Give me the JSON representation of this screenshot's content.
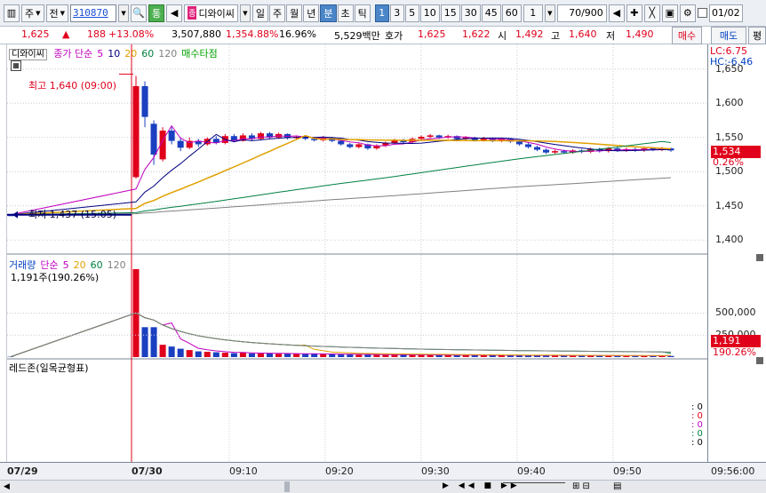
{
  "toolbar": {
    "code": "310870",
    "type1": "주",
    "type2": "전",
    "tong": "통",
    "jong_badge": "종",
    "stock_name": "디와이씨",
    "periods": [
      {
        "label": "일",
        "selected": false
      },
      {
        "label": "주",
        "selected": false
      },
      {
        "label": "월",
        "selected": false
      },
      {
        "label": "년",
        "selected": false
      },
      {
        "label": "분",
        "selected": true
      },
      {
        "label": "초",
        "selected": false
      },
      {
        "label": "틱",
        "selected": false
      }
    ],
    "minutes": [
      {
        "label": "1",
        "selected": true
      },
      {
        "label": "3",
        "selected": false
      },
      {
        "label": "5",
        "selected": false
      },
      {
        "label": "10",
        "selected": false
      },
      {
        "label": "15",
        "selected": false
      },
      {
        "label": "30",
        "selected": false
      },
      {
        "label": "45",
        "selected": false
      },
      {
        "label": "60",
        "selected": false
      }
    ],
    "interval_value": "1",
    "count": "70/900",
    "date": "01/02"
  },
  "quote": {
    "price": "1,625",
    "arrow": "▲",
    "change": "188",
    "change_pct": "+13.08%",
    "volume": "3,507,880",
    "vol_ratio": "1,354.88%",
    "turnover": "16.96%",
    "amount": "5,529백만",
    "hoga_label": "호가",
    "ask": "1,625",
    "bid": "1,622",
    "open_label": "시",
    "open": "1,492",
    "high_label": "고",
    "high": "1,640",
    "low_label": "저",
    "low": "1,490",
    "buy_label": "매수",
    "sell_label": "매도",
    "extra_label": "평"
  },
  "price_pane": {
    "stock_label": "디와이씨",
    "legend": [
      {
        "text": "종가 단순",
        "color": "#c000c0"
      },
      {
        "text": "5",
        "color": "#c000c0"
      },
      {
        "text": "10",
        "color": "#000080"
      },
      {
        "text": "20",
        "color": "#e0a000"
      },
      {
        "text": "60",
        "color": "#008040"
      },
      {
        "text": "120",
        "color": "#808080"
      },
      {
        "text": "매수타점",
        "color": "#00a000"
      }
    ],
    "lc": "LC:6.75",
    "hc": "HC:-6.46",
    "high_marker": "최고 1,640 (09:00)",
    "low_marker": "최저 1,437 (15:05)",
    "ticks": [
      "1,650",
      "1,600",
      "1,550",
      "1,500",
      "1,450",
      "1,400"
    ],
    "current_price": "1,534",
    "current_pct": "0.26%"
  },
  "volume_pane": {
    "legend": [
      {
        "text": "거래량",
        "color": "#0040c0"
      },
      {
        "text": "단순",
        "color": "#c000c0"
      },
      {
        "text": "5",
        "color": "#c000c0"
      },
      {
        "text": "20",
        "color": "#e0a000"
      },
      {
        "text": "60",
        "color": "#008040"
      },
      {
        "text": "120",
        "color": "#808080"
      }
    ],
    "value_text": "1,191주(190.26%)",
    "ticks": [
      "500,000",
      "250,000"
    ],
    "current": "1,191",
    "current_pct": "190.26%"
  },
  "redzone_pane": {
    "title": "레드존(일목균형표)",
    "values": [
      {
        "text": "0",
        "color": "#000000"
      },
      {
        "text": "0",
        "color": "#e0001b"
      },
      {
        "text": "0",
        "color": "#c000c0"
      },
      {
        "text": "0",
        "color": "#008040"
      },
      {
        "text": "0",
        "color": "#000000"
      }
    ]
  },
  "xaxis": {
    "labels": [
      "07/29",
      "07/30",
      "09:10",
      "09:20",
      "09:30",
      "09:40",
      "09:50",
      "09:56:00"
    ]
  },
  "chart_data": {
    "type": "candlestick",
    "title": "",
    "ylim": [
      1390,
      1660
    ],
    "candles": [
      {
        "o": 1437,
        "c": 1437,
        "h": 1437,
        "l": 1437
      },
      {
        "o": 1492,
        "c": 1625,
        "h": 1640,
        "l": 1490,
        "up": true
      },
      {
        "o": 1625,
        "c": 1580,
        "h": 1632,
        "l": 1565
      },
      {
        "o": 1570,
        "c": 1525,
        "h": 1575,
        "l": 1510
      },
      {
        "o": 1518,
        "c": 1560,
        "h": 1565,
        "l": 1515,
        "up": true
      },
      {
        "o": 1560,
        "c": 1545,
        "h": 1565,
        "l": 1540
      },
      {
        "o": 1545,
        "c": 1535,
        "h": 1550,
        "l": 1530
      },
      {
        "o": 1535,
        "c": 1545,
        "h": 1550,
        "l": 1533,
        "up": true
      },
      {
        "o": 1545,
        "c": 1540,
        "h": 1548,
        "l": 1536
      },
      {
        "o": 1540,
        "c": 1548,
        "h": 1550,
        "l": 1538,
        "up": true
      },
      {
        "o": 1548,
        "c": 1542,
        "h": 1552,
        "l": 1540
      },
      {
        "o": 1542,
        "c": 1552,
        "h": 1555,
        "l": 1540,
        "up": true
      },
      {
        "o": 1552,
        "c": 1545,
        "h": 1555,
        "l": 1543
      },
      {
        "o": 1545,
        "c": 1553,
        "h": 1556,
        "l": 1544,
        "up": true
      },
      {
        "o": 1553,
        "c": 1548,
        "h": 1556,
        "l": 1545
      },
      {
        "o": 1548,
        "c": 1556,
        "h": 1558,
        "l": 1546,
        "up": true
      },
      {
        "o": 1556,
        "c": 1550,
        "h": 1558,
        "l": 1548
      },
      {
        "o": 1550,
        "c": 1555,
        "h": 1557,
        "l": 1548,
        "up": true
      },
      {
        "o": 1555,
        "c": 1549,
        "h": 1556,
        "l": 1547
      },
      {
        "o": 1549,
        "c": 1551,
        "h": 1553,
        "l": 1547,
        "up": true
      },
      {
        "o": 1551,
        "c": 1548,
        "h": 1553,
        "l": 1546
      },
      {
        "o": 1548,
        "c": 1546,
        "h": 1550,
        "l": 1544
      },
      {
        "o": 1546,
        "c": 1550,
        "h": 1552,
        "l": 1544,
        "up": true
      },
      {
        "o": 1550,
        "c": 1545,
        "h": 1551,
        "l": 1543
      },
      {
        "o": 1545,
        "c": 1540,
        "h": 1547,
        "l": 1538
      },
      {
        "o": 1540,
        "c": 1536,
        "h": 1542,
        "l": 1534
      },
      {
        "o": 1536,
        "c": 1540,
        "h": 1542,
        "l": 1534,
        "up": true
      },
      {
        "o": 1540,
        "c": 1534,
        "h": 1541,
        "l": 1532
      },
      {
        "o": 1534,
        "c": 1538,
        "h": 1540,
        "l": 1532,
        "up": true
      },
      {
        "o": 1538,
        "c": 1542,
        "h": 1544,
        "l": 1536,
        "up": true
      },
      {
        "o": 1542,
        "c": 1546,
        "h": 1548,
        "l": 1540,
        "up": true
      },
      {
        "o": 1546,
        "c": 1543,
        "h": 1548,
        "l": 1541
      },
      {
        "o": 1543,
        "c": 1548,
        "h": 1550,
        "l": 1541,
        "up": true
      },
      {
        "o": 1548,
        "c": 1551,
        "h": 1553,
        "l": 1546,
        "up": true
      },
      {
        "o": 1551,
        "c": 1553,
        "h": 1555,
        "l": 1549,
        "up": true
      },
      {
        "o": 1553,
        "c": 1550,
        "h": 1554,
        "l": 1548
      },
      {
        "o": 1550,
        "c": 1552,
        "h": 1554,
        "l": 1548,
        "up": true
      },
      {
        "o": 1552,
        "c": 1548,
        "h": 1553,
        "l": 1546
      },
      {
        "o": 1548,
        "c": 1550,
        "h": 1552,
        "l": 1546,
        "up": true
      },
      {
        "o": 1550,
        "c": 1546,
        "h": 1551,
        "l": 1544
      },
      {
        "o": 1546,
        "c": 1549,
        "h": 1551,
        "l": 1544,
        "up": true
      },
      {
        "o": 1549,
        "c": 1545,
        "h": 1550,
        "l": 1543
      },
      {
        "o": 1545,
        "c": 1548,
        "h": 1550,
        "l": 1543,
        "up": true
      },
      {
        "o": 1548,
        "c": 1544,
        "h": 1549,
        "l": 1542
      },
      {
        "o": 1544,
        "c": 1540,
        "h": 1546,
        "l": 1538
      },
      {
        "o": 1540,
        "c": 1536,
        "h": 1542,
        "l": 1534
      },
      {
        "o": 1536,
        "c": 1532,
        "h": 1538,
        "l": 1530
      },
      {
        "o": 1532,
        "c": 1528,
        "h": 1534,
        "l": 1526
      },
      {
        "o": 1528,
        "c": 1530,
        "h": 1532,
        "l": 1526,
        "up": true
      },
      {
        "o": 1530,
        "c": 1528,
        "h": 1532,
        "l": 1526
      },
      {
        "o": 1528,
        "c": 1531,
        "h": 1533,
        "l": 1526,
        "up": true
      },
      {
        "o": 1531,
        "c": 1529,
        "h": 1533,
        "l": 1527
      },
      {
        "o": 1529,
        "c": 1533,
        "h": 1535,
        "l": 1527,
        "up": true
      },
      {
        "o": 1533,
        "c": 1530,
        "h": 1535,
        "l": 1528
      },
      {
        "o": 1530,
        "c": 1534,
        "h": 1536,
        "l": 1528,
        "up": true
      },
      {
        "o": 1534,
        "c": 1531,
        "h": 1536,
        "l": 1529
      },
      {
        "o": 1531,
        "c": 1533,
        "h": 1535,
        "l": 1529,
        "up": true
      },
      {
        "o": 1533,
        "c": 1531,
        "h": 1535,
        "l": 1529
      },
      {
        "o": 1531,
        "c": 1534,
        "h": 1536,
        "l": 1529,
        "up": true
      },
      {
        "o": 1534,
        "c": 1532,
        "h": 1536,
        "l": 1530
      },
      {
        "o": 1532,
        "c": 1534,
        "h": 1536,
        "l": 1530,
        "up": true
      },
      {
        "o": 1534,
        "c": 1531,
        "h": 1535,
        "l": 1529
      }
    ],
    "volumes": [
      4000,
      1000000,
      340000,
      340000,
      140000,
      120000,
      95000,
      80000,
      65000,
      60000,
      55000,
      50000,
      45000,
      50000,
      42000,
      40000,
      45000,
      38000,
      40000,
      36000,
      35000,
      38000,
      34000,
      32000,
      30000,
      30000,
      28000,
      30000,
      27000,
      26000,
      28000,
      25000,
      24000,
      26000,
      23000,
      22000,
      24000,
      22000,
      21000,
      22000,
      20000,
      21000,
      20000,
      19000,
      20000,
      19000,
      18000,
      19000,
      18000,
      17000,
      18000,
      17000,
      16000,
      17000,
      16000,
      15000,
      16000,
      15000,
      14000,
      15000,
      14000,
      13000
    ]
  }
}
